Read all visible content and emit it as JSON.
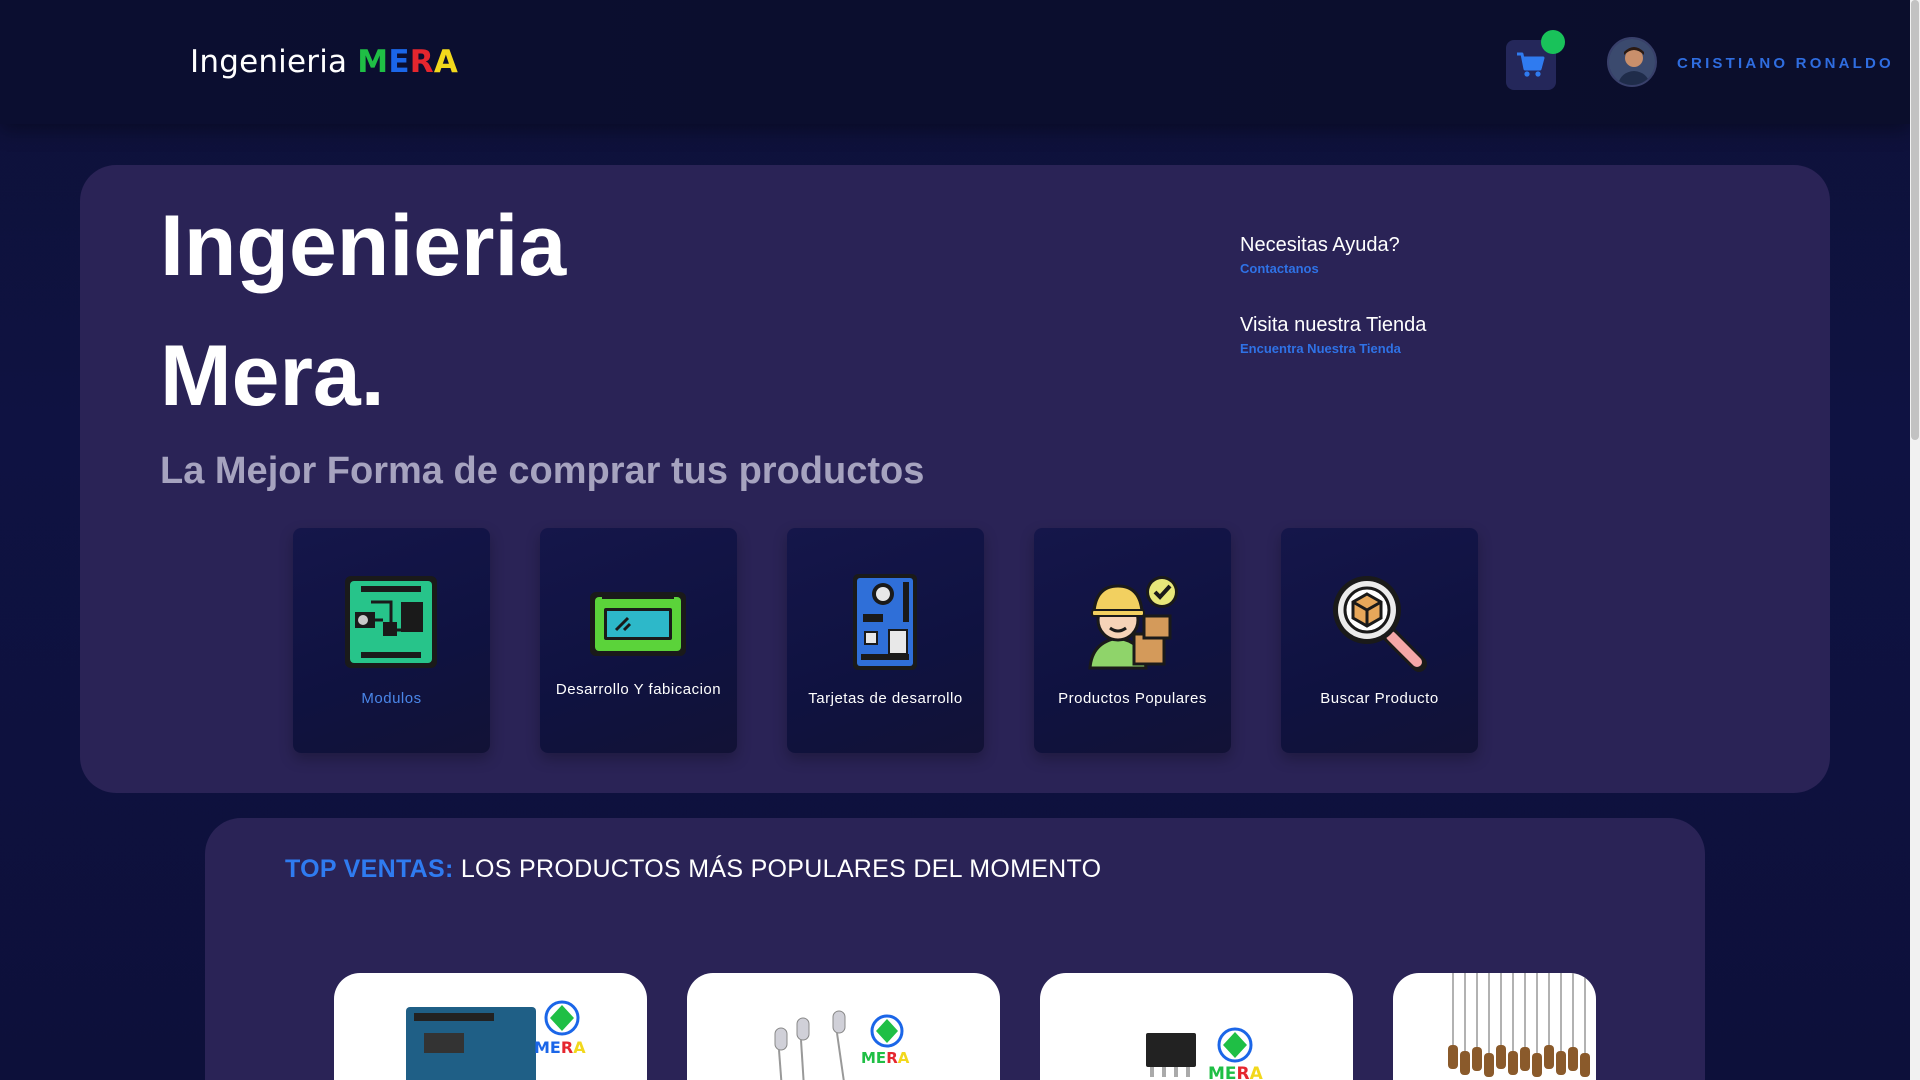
{
  "header": {
    "brand_prefix": "Ingenieria ",
    "brand_letters": [
      "M",
      "E",
      "R",
      "A"
    ],
    "user_name": "CRISTIANO RONALDO",
    "cart_icon": "cart-icon"
  },
  "hero": {
    "title_line1": "Ingenieria",
    "title_line2": "Mera.",
    "subtitle": "La Mejor Forma de comprar tus productos",
    "help": [
      {
        "title": "Necesitas Ayuda?",
        "link": "Contactanos"
      },
      {
        "title": "Visita nuestra Tienda",
        "link": "Encuentra Nuestra Tienda"
      }
    ]
  },
  "categories": [
    {
      "label": "Modulos",
      "icon": "circuit-board-icon"
    },
    {
      "label": "Desarrollo Y fabicacion",
      "icon": "lcd-module-icon"
    },
    {
      "label": "Tarjetas de desarrollo",
      "icon": "dev-board-icon"
    },
    {
      "label": "Productos Populares",
      "icon": "worker-check-icon"
    },
    {
      "label": "Buscar Producto",
      "icon": "search-box-icon"
    }
  ],
  "top_ventas": {
    "accent": "TOP VENTAS:",
    "rest": " LOS PRODUCTOS MÁS POPULARES DEL MOMENTO"
  },
  "products": [
    {
      "image": "arduino-board-image"
    },
    {
      "image": "led-diodes-image"
    },
    {
      "image": "ic-chip-image"
    },
    {
      "image": "resistors-image"
    }
  ],
  "colors": {
    "accent_blue": "#2f7bf0",
    "hero_bg": "#2a2356",
    "page_bg": "#0e1138",
    "online_green": "#19c25a"
  }
}
